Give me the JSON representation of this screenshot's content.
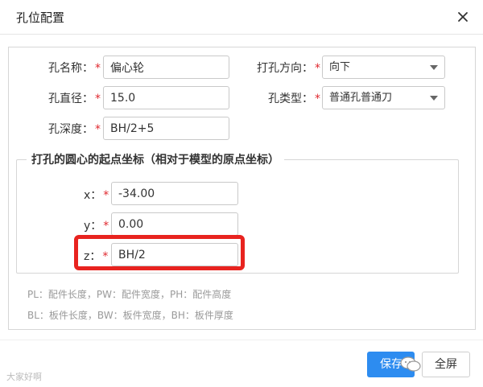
{
  "dialog": {
    "title": "孔位配置"
  },
  "form": {
    "hole_name": {
      "label": "孔名称：",
      "required": "*",
      "value": "偏心轮"
    },
    "drill_direction": {
      "label": "打孔方向：",
      "required": "*",
      "value": "向下"
    },
    "hole_diameter": {
      "label": "孔直径：",
      "required": "*",
      "value": "15.0"
    },
    "hole_type": {
      "label": "孔类型：",
      "required": "*",
      "value": "普通孔普通刀"
    },
    "hole_depth": {
      "label": "孔深度：",
      "required": "*",
      "value": "BH/2+5"
    }
  },
  "coords": {
    "legend": "打孔的圆心的起点坐标（相对于模型的原点坐标）",
    "x": {
      "label": "x：",
      "required": "*",
      "value": "-34.00"
    },
    "y": {
      "label": "y：",
      "required": "*",
      "value": "0.00"
    },
    "z": {
      "label": "z：",
      "required": "*",
      "value": "BH/2"
    }
  },
  "hints": {
    "line1": "PL：配件长度，PW：配件宽度，PH：配件高度",
    "line2": "BL：板件长度，BW：板件宽度，BH：板件厚度"
  },
  "footer": {
    "save_label": "保存",
    "fullscreen_label": "全屏",
    "watermark": "大家好啊"
  },
  "colors": {
    "accent": "#2d8cf0",
    "required": "#e0282e",
    "highlight": "#e8231f"
  }
}
